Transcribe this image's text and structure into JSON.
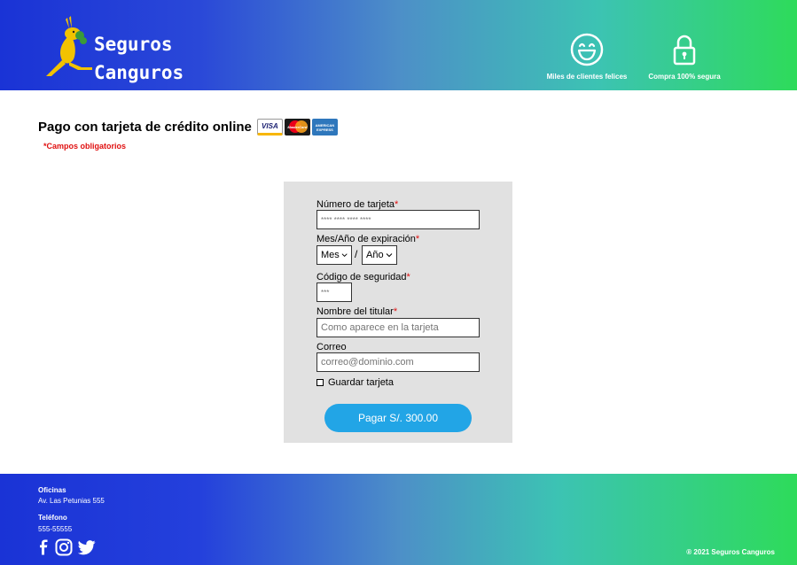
{
  "header": {
    "brand_line1": "Seguros",
    "brand_line2": "Canguros",
    "features": [
      {
        "label": "Miles de clientes felices",
        "icon": "smiley-icon"
      },
      {
        "label": "Compra 100% segura",
        "icon": "padlock-icon"
      }
    ]
  },
  "main": {
    "title": "Pago con tarjeta de crédito online",
    "cards": {
      "visa": "VISA",
      "mastercard": "MasterCard",
      "amex": "AMERICAN EXPRESS"
    },
    "required_note": "*Campos obligatorios"
  },
  "form": {
    "card_number": {
      "label": "Número de tarjeta",
      "required": "*",
      "placeholder": "**** **** **** ****"
    },
    "expiration": {
      "label": "Mes/Año de expiración",
      "required": "*",
      "month": "Mes",
      "separator": "/",
      "year": "Año"
    },
    "security_code": {
      "label": "Código de seguridad",
      "required": "*",
      "placeholder": "***"
    },
    "holder_name": {
      "label": "Nombre del titular",
      "required": "*",
      "placeholder": "Como aparece en la tarjeta"
    },
    "email": {
      "label": "Correo",
      "placeholder": "correo@dominio.com"
    },
    "save_card": {
      "label": "Guardar tarjeta",
      "checked": false
    },
    "pay_button": "Pagar S/. 300.00"
  },
  "footer": {
    "offices_label": "Oficinas",
    "offices_value": "Av. Las Petunias 555",
    "phone_label": "Teléfono",
    "phone_value": "555-55555",
    "copyright": "® 2021 Seguros Canguros"
  },
  "colors": {
    "header_start": "#1a33d6",
    "header_end": "#2edb5a",
    "required": "#e01010",
    "button": "#22a5e6",
    "panel": "#e1e1e1"
  }
}
